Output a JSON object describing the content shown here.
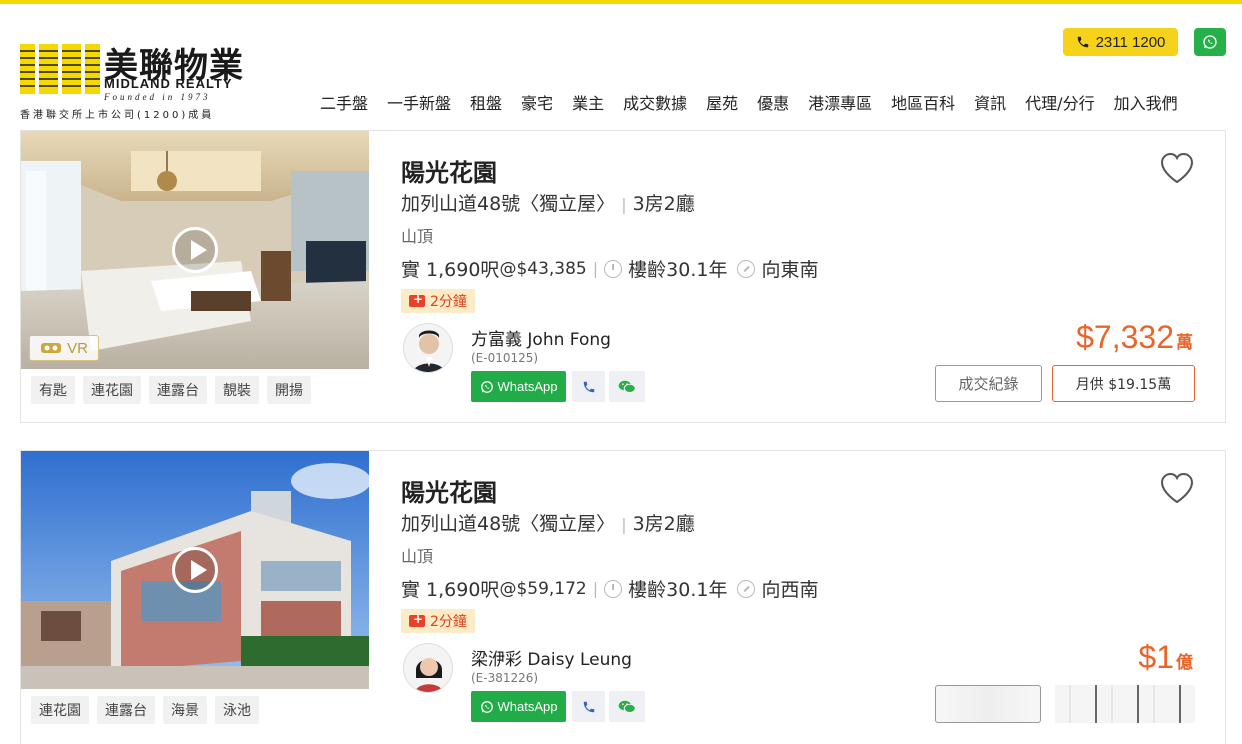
{
  "brand": {
    "name_zh": "美聯物業",
    "name_en": "MIDLAND REALTY",
    "founded": "Founded in 1973",
    "subtitle": "香港聯交所上市公司(1200)成員"
  },
  "header": {
    "phone": "2311 1200",
    "nav": [
      "二手盤",
      "一手新盤",
      "租盤",
      "豪宅",
      "業主",
      "成交數據",
      "屋苑",
      "優惠",
      "港漂專區",
      "地區百科",
      "資訊",
      "代理/分行",
      "加入我們"
    ]
  },
  "colors": {
    "brand_yellow": "#f5d800",
    "price_orange": "#e8652b",
    "whatsapp_green": "#21ac47"
  },
  "listings": [
    {
      "title": "陽光花園",
      "address": "加列山道48號〈獨立屋〉",
      "rooms": "3房2廳",
      "district": "山頂",
      "area": "實 1,690呎",
      "unit_price": "@$43,385",
      "age": "樓齡30.1年",
      "facing": "向東南",
      "time_badge": "2分鐘",
      "vr_label": "VR",
      "tags": [
        "有匙",
        "連花園",
        "連露台",
        "靚裝",
        "開揚"
      ],
      "agent_name": "方富義 John Fong",
      "agent_id": "(E-010125)",
      "whatsapp_label": "WhatsApp",
      "price_amount": "$7,332",
      "price_unit": "萬",
      "record_label": "成交紀錄",
      "mortgage_label": "月供 $19.15萬"
    },
    {
      "title": "陽光花園",
      "address": "加列山道48號〈獨立屋〉",
      "rooms": "3房2廳",
      "district": "山頂",
      "area": "實 1,690呎",
      "unit_price": "@$59,172",
      "age": "樓齡30.1年",
      "facing": "向西南",
      "time_badge": "2分鐘",
      "tags": [
        "連花園",
        "連露台",
        "海景",
        "泳池"
      ],
      "agent_name": "梁洢彩 Daisy Leung",
      "agent_id": "(E-381226)",
      "whatsapp_label": "WhatsApp",
      "price_amount": "$1",
      "price_unit": "億"
    }
  ]
}
